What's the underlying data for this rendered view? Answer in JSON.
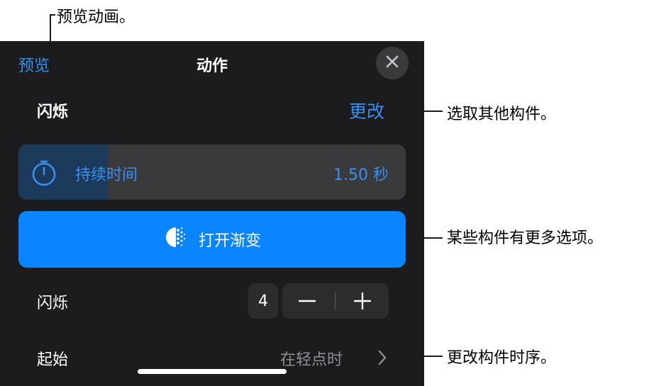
{
  "callouts": {
    "preview": "预览动画。",
    "change": "选取其他构件。",
    "options": "某些构件有更多选项。",
    "timing": "更改构件时序。"
  },
  "header": {
    "preview_label": "预览",
    "title": "动作",
    "close_icon": "close-icon"
  },
  "effect": {
    "name": "闪烁",
    "change_label": "更改"
  },
  "duration": {
    "label": "持续时间",
    "value": "1.50 秒",
    "icon": "stopwatch-icon",
    "fill_fraction": 0.23
  },
  "gradient_button": {
    "label": "打开渐变",
    "icon": "gradient-icon"
  },
  "flashes": {
    "label": "闪烁",
    "count": "4",
    "minus_icon": "minus-icon",
    "plus_icon": "plus-icon"
  },
  "start": {
    "label": "起始",
    "value": "在轻点时",
    "icon": "chevron-right-icon"
  },
  "colors": {
    "accent": "#0a84ff",
    "link": "#3a8ff0",
    "panel_bg": "#1c1c1e",
    "control_bg": "#3a3a3c"
  }
}
